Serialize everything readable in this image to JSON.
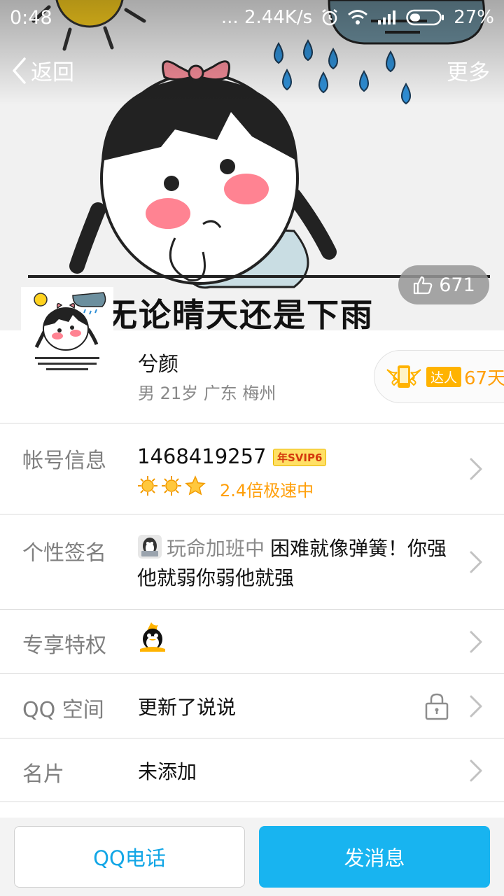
{
  "status_bar": {
    "time": "0:48",
    "network_speed": "... 2.44K/s",
    "battery": "27%"
  },
  "nav": {
    "back_label": "返回",
    "more_label": "更多"
  },
  "cover": {
    "caption": "无论晴天还是下雨"
  },
  "likes": {
    "count": "671"
  },
  "profile": {
    "nickname": "兮颜",
    "meta": "男 21岁 广东 梅州",
    "vip_tag": "达人",
    "vip_days": "67天"
  },
  "rows": {
    "account": {
      "label": "帐号信息",
      "number": "1468419257",
      "svip_badge": "年SVIP6",
      "speed": "2.4倍极速中"
    },
    "signature": {
      "label": "个性签名",
      "status": "玩命加班中",
      "text": "困难就像弹簧！你强他就弱你弱他就强"
    },
    "privilege": {
      "label": "专享特权"
    },
    "qzone": {
      "label": "QQ 空间",
      "value": "更新了说说"
    },
    "card": {
      "label": "名片",
      "value": "未添加"
    }
  },
  "bottom": {
    "call_label": "QQ电话",
    "message_label": "发消息"
  },
  "colors": {
    "accent_blue": "#18b4f0",
    "vip_orange": "#ff9f0a"
  }
}
